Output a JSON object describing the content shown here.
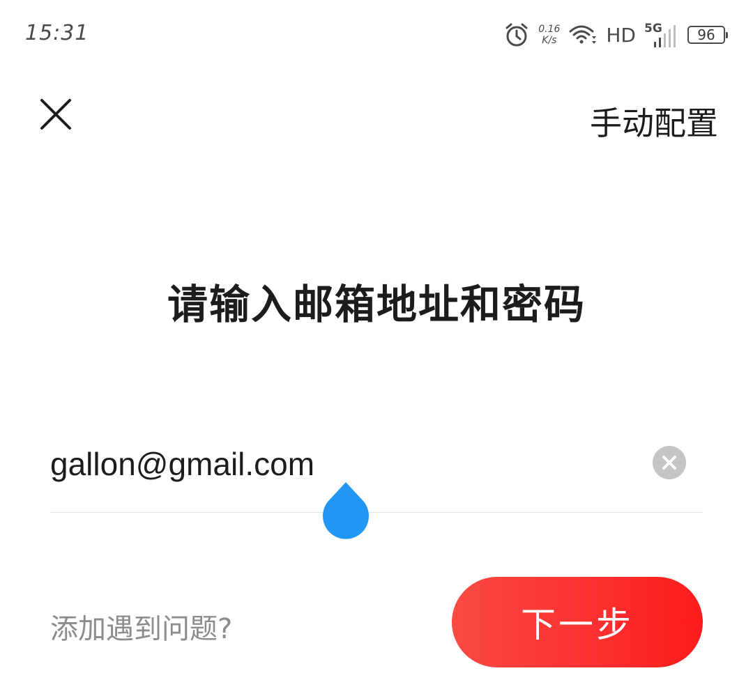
{
  "status_bar": {
    "time": "15:31",
    "net_speed_value": "0.16",
    "net_speed_unit": "K/s",
    "hd_label": "HD",
    "network_type": "5G",
    "battery_level": "96",
    "icons": [
      "alarm-icon",
      "wifi-icon",
      "signal-icon",
      "battery-icon"
    ]
  },
  "header": {
    "close_icon": "close-icon",
    "manual_config_label": "手动配置"
  },
  "main": {
    "title": "请输入邮箱地址和密码",
    "email_value": "gallon@gmail.com",
    "clear_icon": "clear-icon",
    "help_link": "添加遇到问题?",
    "next_button": "下一步"
  },
  "colors": {
    "accent_red": "#fc2f2f",
    "cursor_blue": "#2196f3",
    "clear_gray": "#c4c4c4",
    "help_gray": "#8c8c8c"
  }
}
